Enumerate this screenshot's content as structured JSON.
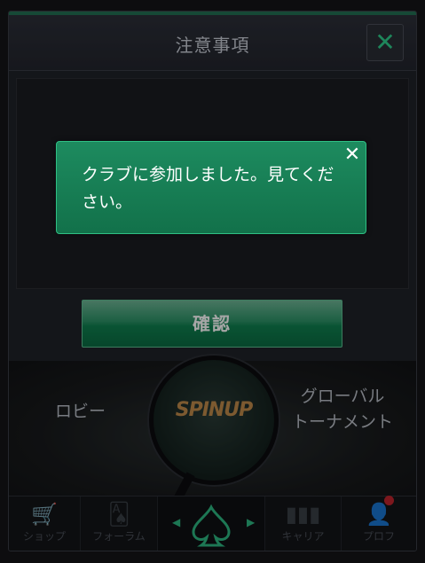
{
  "modal": {
    "title": "注意事項",
    "close_icon": "close-icon",
    "confirm_label": "確認"
  },
  "lobby": {
    "left_label": "ロビー",
    "right_label_line1": "グローバル",
    "right_label_line2": "トーナメント",
    "center_logo": "SPINUP"
  },
  "nav": {
    "shop": "ショップ",
    "forum": "フォーラム",
    "career": "キャリア",
    "profile": "プロフ"
  },
  "toast": {
    "message": "クラブに参加しました。見てください。",
    "close_icon": "close-icon"
  },
  "colors": {
    "accent": "#2fce8c",
    "toast_bg": "#17805a",
    "badge": "#c0242d"
  }
}
